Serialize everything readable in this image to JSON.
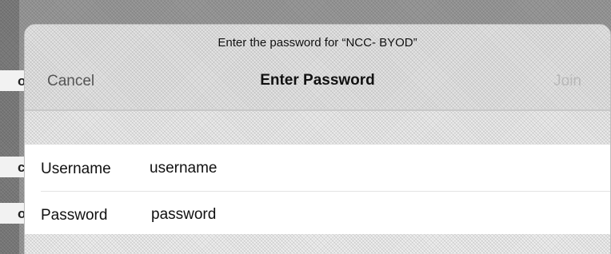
{
  "background": {
    "row_letters": [
      "o",
      "c",
      "o"
    ]
  },
  "dialog": {
    "prompt": "Enter the password for “NCC-  BYOD”",
    "cancel_label": "Cancel",
    "title": "Enter Password",
    "join_label": "Join",
    "fields": [
      {
        "label": "Username",
        "value": "username"
      },
      {
        "label": "Password",
        "value": "password"
      }
    ]
  },
  "colors": {
    "sheet": "#ffffff",
    "nav_bar": "#e4e4e4",
    "join_disabled": "#b8b8b8",
    "cancel": "#555555"
  }
}
